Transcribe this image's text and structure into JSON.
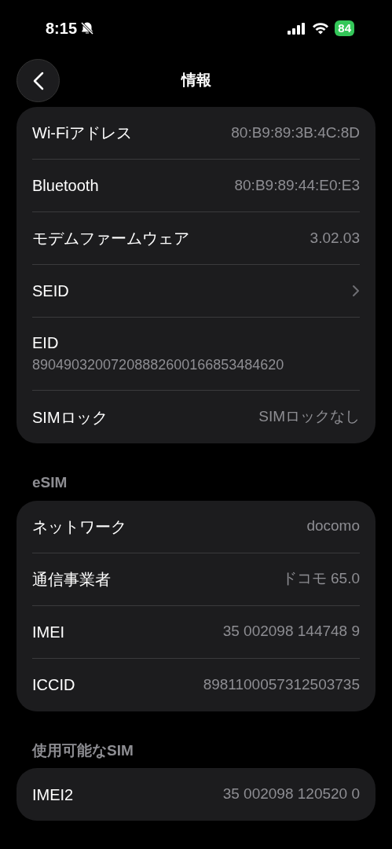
{
  "status_bar": {
    "time": "8:15",
    "battery": "84"
  },
  "nav": {
    "title": "情報"
  },
  "sections": [
    {
      "rows": [
        {
          "kind": "value",
          "label": "Wi-Fiアドレス",
          "value": "80:B9:89:3B:4C:8D"
        },
        {
          "kind": "value",
          "label": "Bluetooth",
          "value": "80:B9:89:44:E0:E3"
        },
        {
          "kind": "value",
          "label": "モデムファームウェア",
          "value": "3.02.03"
        },
        {
          "kind": "link",
          "label": "SEID"
        },
        {
          "kind": "stacked",
          "label": "EID",
          "value": "89049032007208882600166853484620"
        },
        {
          "kind": "value",
          "label": "SIMロック",
          "value": "SIMロックなし"
        }
      ]
    },
    {
      "header": "eSIM",
      "rows": [
        {
          "kind": "value",
          "label": "ネットワーク",
          "value": "docomo"
        },
        {
          "kind": "value",
          "label": "通信事業者",
          "value": "ドコモ 65.0"
        },
        {
          "kind": "value",
          "label": "IMEI",
          "value": "35 002098 144748 9"
        },
        {
          "kind": "value",
          "label": "ICCID",
          "value": "8981100057312503735"
        }
      ]
    },
    {
      "header": "使用可能なSIM",
      "rows": [
        {
          "kind": "value",
          "label": "IMEI2",
          "value": "35 002098 120520 0"
        }
      ]
    }
  ]
}
